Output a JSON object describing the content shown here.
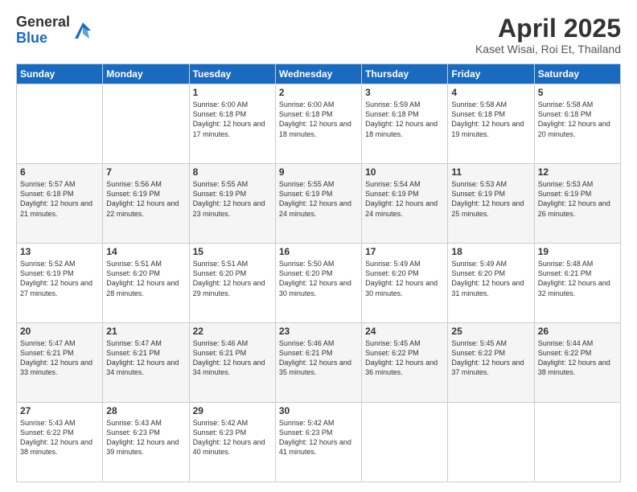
{
  "header": {
    "logo_general": "General",
    "logo_blue": "Blue",
    "title": "April 2025",
    "location": "Kaset Wisai, Roi Et, Thailand"
  },
  "days_of_week": [
    "Sunday",
    "Monday",
    "Tuesday",
    "Wednesday",
    "Thursday",
    "Friday",
    "Saturday"
  ],
  "weeks": [
    [
      {
        "day": "",
        "info": ""
      },
      {
        "day": "",
        "info": ""
      },
      {
        "day": "1",
        "info": "Sunrise: 6:00 AM\nSunset: 6:18 PM\nDaylight: 12 hours and 17 minutes."
      },
      {
        "day": "2",
        "info": "Sunrise: 6:00 AM\nSunset: 6:18 PM\nDaylight: 12 hours and 18 minutes."
      },
      {
        "day": "3",
        "info": "Sunrise: 5:59 AM\nSunset: 6:18 PM\nDaylight: 12 hours and 18 minutes."
      },
      {
        "day": "4",
        "info": "Sunrise: 5:58 AM\nSunset: 6:18 PM\nDaylight: 12 hours and 19 minutes."
      },
      {
        "day": "5",
        "info": "Sunrise: 5:58 AM\nSunset: 6:18 PM\nDaylight: 12 hours and 20 minutes."
      }
    ],
    [
      {
        "day": "6",
        "info": "Sunrise: 5:57 AM\nSunset: 6:18 PM\nDaylight: 12 hours and 21 minutes."
      },
      {
        "day": "7",
        "info": "Sunrise: 5:56 AM\nSunset: 6:19 PM\nDaylight: 12 hours and 22 minutes."
      },
      {
        "day": "8",
        "info": "Sunrise: 5:55 AM\nSunset: 6:19 PM\nDaylight: 12 hours and 23 minutes."
      },
      {
        "day": "9",
        "info": "Sunrise: 5:55 AM\nSunset: 6:19 PM\nDaylight: 12 hours and 24 minutes."
      },
      {
        "day": "10",
        "info": "Sunrise: 5:54 AM\nSunset: 6:19 PM\nDaylight: 12 hours and 24 minutes."
      },
      {
        "day": "11",
        "info": "Sunrise: 5:53 AM\nSunset: 6:19 PM\nDaylight: 12 hours and 25 minutes."
      },
      {
        "day": "12",
        "info": "Sunrise: 5:53 AM\nSunset: 6:19 PM\nDaylight: 12 hours and 26 minutes."
      }
    ],
    [
      {
        "day": "13",
        "info": "Sunrise: 5:52 AM\nSunset: 6:19 PM\nDaylight: 12 hours and 27 minutes."
      },
      {
        "day": "14",
        "info": "Sunrise: 5:51 AM\nSunset: 6:20 PM\nDaylight: 12 hours and 28 minutes."
      },
      {
        "day": "15",
        "info": "Sunrise: 5:51 AM\nSunset: 6:20 PM\nDaylight: 12 hours and 29 minutes."
      },
      {
        "day": "16",
        "info": "Sunrise: 5:50 AM\nSunset: 6:20 PM\nDaylight: 12 hours and 30 minutes."
      },
      {
        "day": "17",
        "info": "Sunrise: 5:49 AM\nSunset: 6:20 PM\nDaylight: 12 hours and 30 minutes."
      },
      {
        "day": "18",
        "info": "Sunrise: 5:49 AM\nSunset: 6:20 PM\nDaylight: 12 hours and 31 minutes."
      },
      {
        "day": "19",
        "info": "Sunrise: 5:48 AM\nSunset: 6:21 PM\nDaylight: 12 hours and 32 minutes."
      }
    ],
    [
      {
        "day": "20",
        "info": "Sunrise: 5:47 AM\nSunset: 6:21 PM\nDaylight: 12 hours and 33 minutes."
      },
      {
        "day": "21",
        "info": "Sunrise: 5:47 AM\nSunset: 6:21 PM\nDaylight: 12 hours and 34 minutes."
      },
      {
        "day": "22",
        "info": "Sunrise: 5:46 AM\nSunset: 6:21 PM\nDaylight: 12 hours and 34 minutes."
      },
      {
        "day": "23",
        "info": "Sunrise: 5:46 AM\nSunset: 6:21 PM\nDaylight: 12 hours and 35 minutes."
      },
      {
        "day": "24",
        "info": "Sunrise: 5:45 AM\nSunset: 6:22 PM\nDaylight: 12 hours and 36 minutes."
      },
      {
        "day": "25",
        "info": "Sunrise: 5:45 AM\nSunset: 6:22 PM\nDaylight: 12 hours and 37 minutes."
      },
      {
        "day": "26",
        "info": "Sunrise: 5:44 AM\nSunset: 6:22 PM\nDaylight: 12 hours and 38 minutes."
      }
    ],
    [
      {
        "day": "27",
        "info": "Sunrise: 5:43 AM\nSunset: 6:22 PM\nDaylight: 12 hours and 38 minutes."
      },
      {
        "day": "28",
        "info": "Sunrise: 5:43 AM\nSunset: 6:23 PM\nDaylight: 12 hours and 39 minutes."
      },
      {
        "day": "29",
        "info": "Sunrise: 5:42 AM\nSunset: 6:23 PM\nDaylight: 12 hours and 40 minutes."
      },
      {
        "day": "30",
        "info": "Sunrise: 5:42 AM\nSunset: 6:23 PM\nDaylight: 12 hours and 41 minutes."
      },
      {
        "day": "",
        "info": ""
      },
      {
        "day": "",
        "info": ""
      },
      {
        "day": "",
        "info": ""
      }
    ]
  ]
}
